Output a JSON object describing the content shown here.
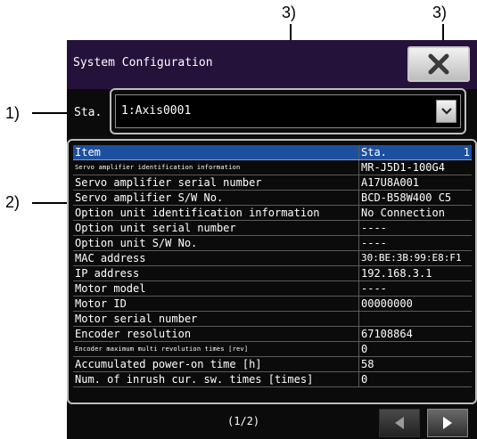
{
  "callouts": {
    "c1": "1)",
    "c2": "2)",
    "c3a": "3)",
    "c3b": "3)"
  },
  "window": {
    "title": "System Configuration",
    "close_icon": "close-x-icon"
  },
  "station": {
    "label": "Sta.",
    "selected": "1:Axis0001",
    "dropdown_icon": "chevron-down-icon"
  },
  "table": {
    "header": {
      "item": "Item",
      "sta": "Sta.",
      "sta_num": "1"
    },
    "rows": [
      {
        "item": "Servo amplifier identification information",
        "value": "MR-J5D1-100G4"
      },
      {
        "item": "Servo amplifier serial number",
        "value": "A17U8A001"
      },
      {
        "item": "Servo amplifier S/W No.",
        "value": "BCD-B58W400 C5"
      },
      {
        "item": "Option unit identification information",
        "value": "No Connection"
      },
      {
        "item": "Option unit serial number",
        "value": "----"
      },
      {
        "item": "Option unit S/W No.",
        "value": "----"
      },
      {
        "item": "MAC address",
        "value": "30:BE:3B:99:E8:F1"
      },
      {
        "item": "IP address",
        "value": "192.168.3.1"
      },
      {
        "item": "Motor model",
        "value": "----"
      },
      {
        "item": "Motor ID",
        "value": "00000000"
      },
      {
        "item": "Motor serial number",
        "value": ""
      },
      {
        "item": "Encoder resolution",
        "value": "67108864"
      },
      {
        "item": "Encoder maximum multi revolution times [rev]",
        "value": "0"
      },
      {
        "item": "Accumulated power-on time [h]",
        "value": "58"
      },
      {
        "item": "Num. of inrush cur. sw. times [times]",
        "value": "0"
      }
    ]
  },
  "pager": {
    "text": "(1/2)",
    "prev_icon": "triangle-left-icon",
    "next_icon": "triangle-right-icon"
  }
}
